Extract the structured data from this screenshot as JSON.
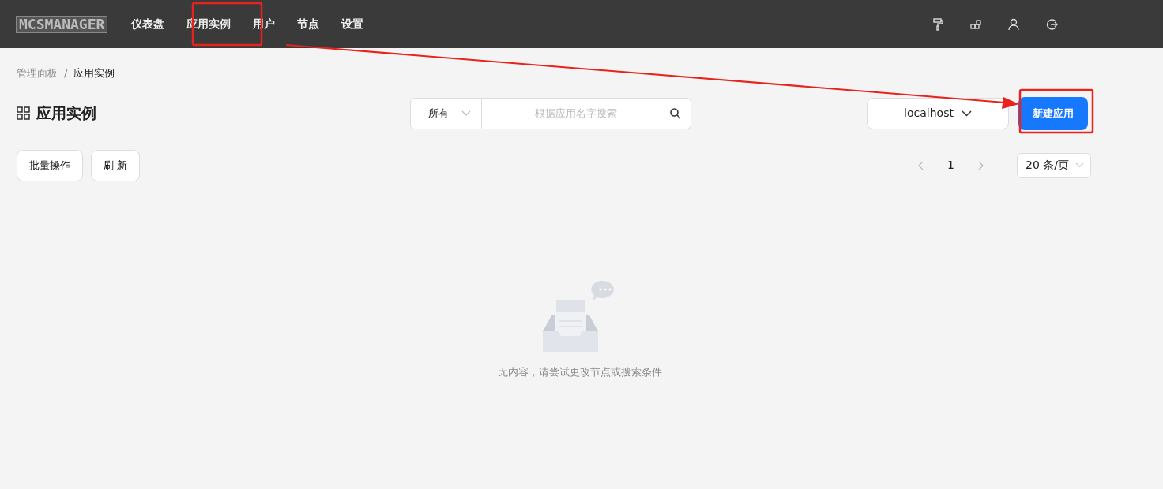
{
  "navbar": {
    "logo": "MCSMANAGER",
    "items": [
      {
        "label": "仪表盘"
      },
      {
        "label": "应用实例"
      },
      {
        "label": "用户"
      },
      {
        "label": "节点"
      },
      {
        "label": "设置"
      }
    ]
  },
  "breadcrumb": [
    "管理面板",
    "/",
    "应用实例"
  ],
  "page_title": "应用实例",
  "search": {
    "filter": "所有",
    "placeholder": "根据应用名字搜索"
  },
  "node_select": "localhost",
  "create_button": "新建应用",
  "actions": [
    "批量操作",
    "刷 新"
  ],
  "pagination": {
    "page": "1",
    "page_size": "20 条/页"
  },
  "empty_message": "无内容，请尝试更改节点或搜索条件"
}
